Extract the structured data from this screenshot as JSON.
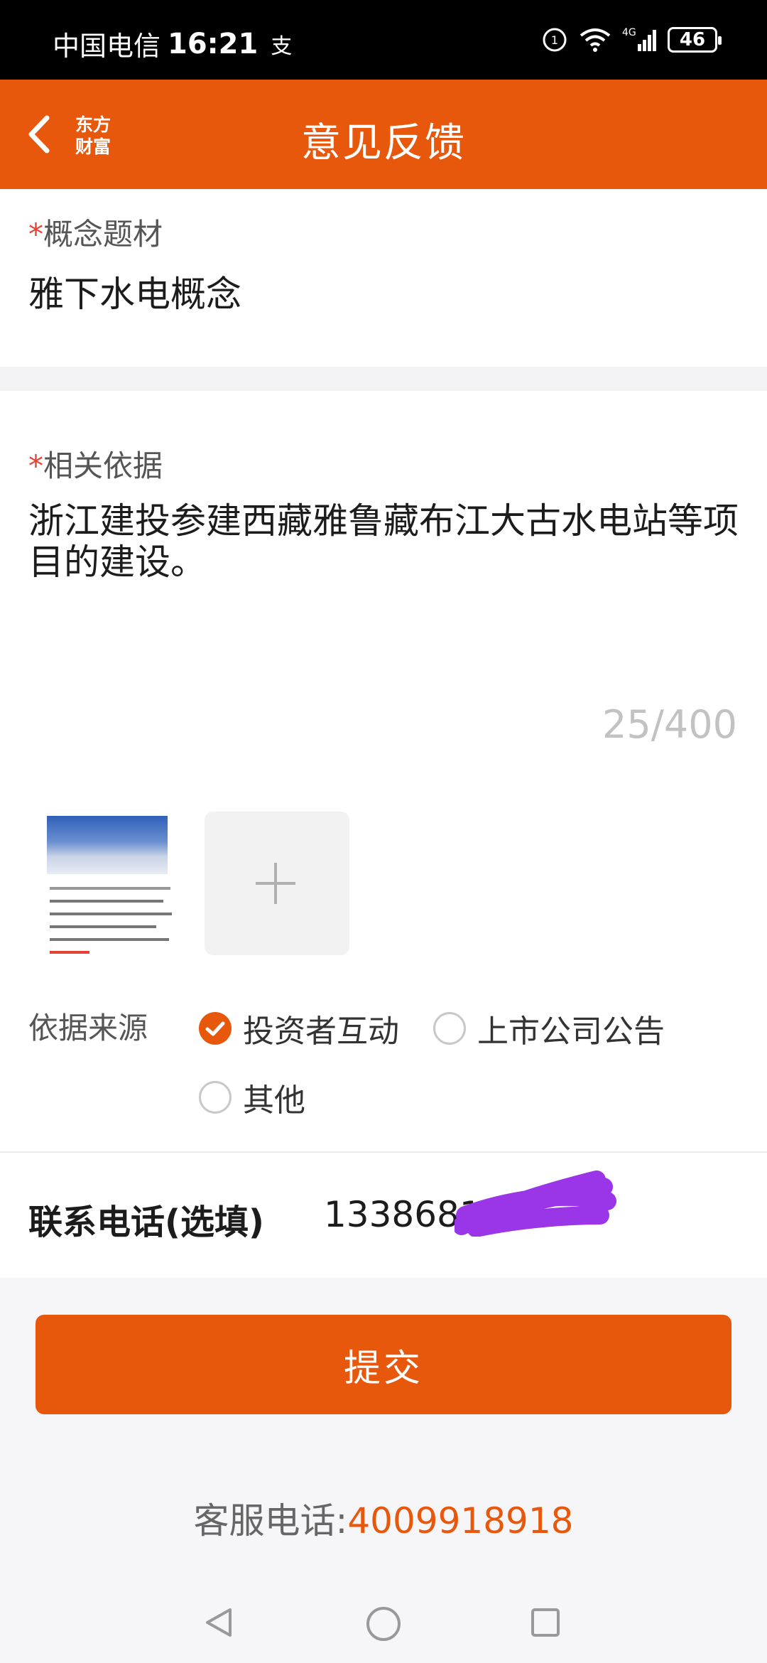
{
  "status_bar": {
    "carrier": "中国电信",
    "time": "16:21",
    "extra_icon": "alipay-icon",
    "battery": "46"
  },
  "nav": {
    "title": "意见反馈",
    "logo_line1": "东方",
    "logo_line2": "财富"
  },
  "topic": {
    "required_mark": "*",
    "label": "概念题材",
    "value": "雅下水电概念"
  },
  "basis": {
    "required_mark": "*",
    "label": "相关依据",
    "text": "浙江建投参建西藏雅鲁藏布江大古水电站等项目的建设。",
    "counter": "25/400"
  },
  "attachments": {
    "thumbnail": "screenshot-thumbnail",
    "add_icon": "plus-icon"
  },
  "source": {
    "label": "依据来源",
    "options": [
      {
        "label": "投资者互动",
        "checked": true
      },
      {
        "label": "上市公司公告",
        "checked": false
      },
      {
        "label": "其他",
        "checked": false
      }
    ]
  },
  "contact": {
    "label": "联系电话(选填)",
    "value": "1338681"
  },
  "submit": {
    "label": "提交"
  },
  "service": {
    "label": "客服电话:",
    "number": "4009918918"
  },
  "colors": {
    "accent": "#e8580c",
    "required": "#e34234",
    "redaction": "#9b35e8"
  }
}
